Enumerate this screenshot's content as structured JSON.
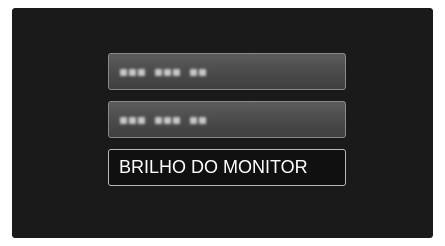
{
  "menu": {
    "items": [
      {
        "label": "",
        "state": "obscured"
      },
      {
        "label": "",
        "state": "obscured"
      },
      {
        "label": "BRILHO DO MONITOR",
        "state": "selected"
      }
    ]
  },
  "colors": {
    "screen_background": "#1a1a1a",
    "item_background": "#4a4a4a",
    "selected_background": "#101010",
    "text": "#ffffff"
  }
}
